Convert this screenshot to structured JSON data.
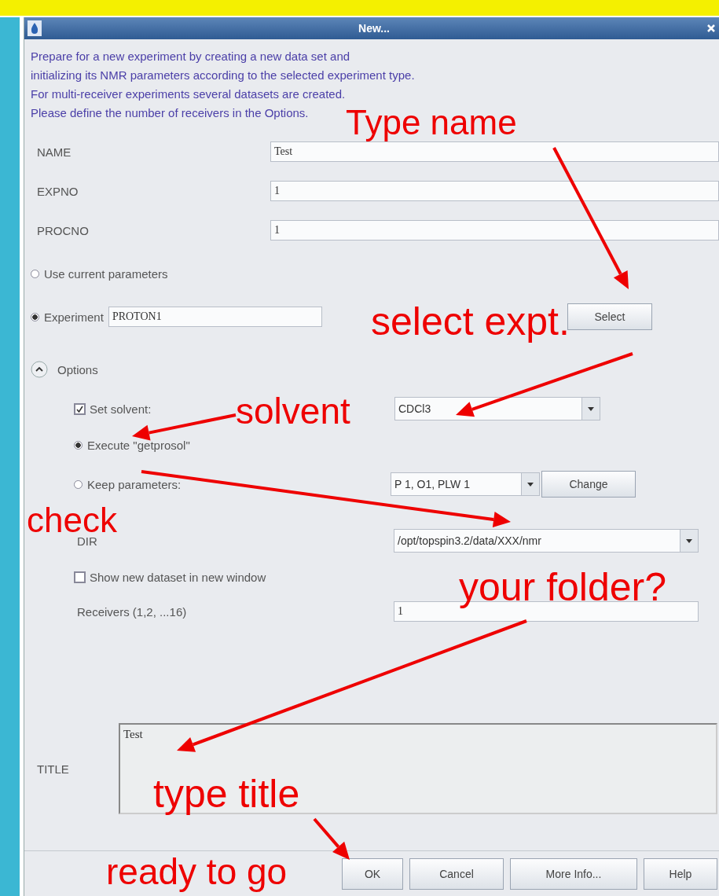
{
  "window": {
    "title": "New..."
  },
  "description": [
    "Prepare for a new experiment by creating a new data set and",
    "initializing its NMR parameters according to the selected experiment type.",
    "For multi-receiver experiments several datasets are created.",
    "Please define the number of receivers in the Options."
  ],
  "fields": [
    {
      "label": "NAME",
      "value": "Test"
    },
    {
      "label": "EXPNO",
      "value": "1"
    },
    {
      "label": "PROCNO",
      "value": "1"
    }
  ],
  "parameter_source": [
    {
      "label": "Use current parameters",
      "selected": false
    },
    {
      "label": "Experiment",
      "selected": true,
      "value": "PROTON1",
      "button": "Select"
    }
  ],
  "options": {
    "label": "Options",
    "expanded": true,
    "set_solvent": {
      "label": "Set solvent:",
      "checked": true,
      "value": "CDCl3"
    },
    "prosol": [
      {
        "label": "Execute \"getprosol\"",
        "selected": true
      },
      {
        "label": "Keep parameters:",
        "selected": false,
        "value": "P 1, O1, PLW 1",
        "button": "Change"
      }
    ],
    "dir": {
      "label": "DIR",
      "value": "/opt/topspin3.2/data/XXX/nmr"
    },
    "show_new_window": {
      "label": "Show new dataset in new window",
      "checked": false
    },
    "receivers": {
      "label": "Receivers (1,2, ...16)",
      "value": "1"
    }
  },
  "title_field": {
    "label": "TITLE",
    "value": "Test"
  },
  "buttons": [
    "OK",
    "Cancel",
    "More Info...",
    "Help"
  ],
  "annotations": [
    {
      "text": "Type name"
    },
    {
      "text": "select expt."
    },
    {
      "text": "solvent"
    },
    {
      "text": "check"
    },
    {
      "text": "your folder?"
    },
    {
      "text": "type title"
    },
    {
      "text": "ready to go"
    }
  ]
}
